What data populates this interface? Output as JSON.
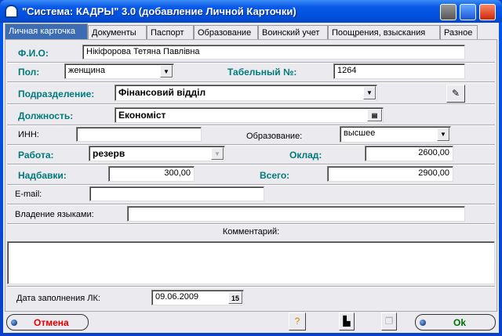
{
  "window": {
    "title": "\"Система: КАДРЫ\" 3.0 (добавление Личной Карточки)"
  },
  "tabs": [
    "Личная карточка",
    "Документы",
    "Паспорт",
    "Образование",
    "Воинский учет",
    "Поощрения, взыскания",
    "Разное"
  ],
  "form": {
    "fio_label": "Ф.И.О:",
    "fio": "Нікіфорова Тетяна Павлівна",
    "pol_label": "Пол:",
    "pol": "женщина",
    "tab_label": "Табельный №:",
    "tab": "1264",
    "podr_label": "Подразделение:",
    "podr": "Фінансовий відділ",
    "dolzh_label": "Должность:",
    "dolzh": "Економіст",
    "inn_label": "ИНН:",
    "inn": "",
    "obr_label": "Образование:",
    "obr": "высшее",
    "rabota_label": "Работа:",
    "rabota": "резерв",
    "oklad_label": "Оклад:",
    "oklad": "2600,00",
    "nadb_label": "Надбавки:",
    "nadb": "300,00",
    "vsego_label": "Всего:",
    "vsego": "2900,00",
    "email_label": "E-mail:",
    "email": "",
    "lang_label": "Владение языками:",
    "lang": "",
    "comment_label": "Комментарий:",
    "comment": "",
    "date_label": "Дата заполнения ЛК:",
    "date": "09.06.2009",
    "cal": "15"
  },
  "buttons": {
    "cancel": "Отмена",
    "ok": "Ok"
  },
  "colors": {
    "label": "#007a7a",
    "cancel": "#e00000",
    "ok": "#007000"
  }
}
